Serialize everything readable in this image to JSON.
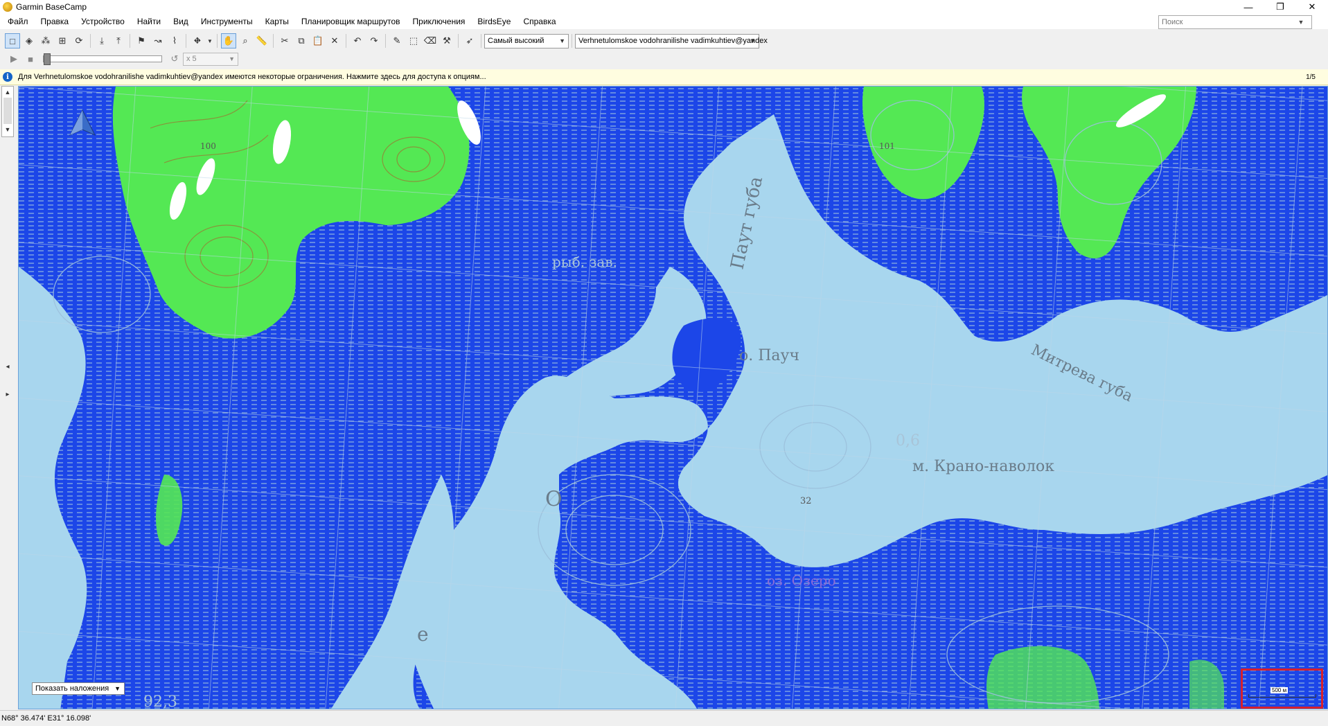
{
  "window": {
    "title": "Garmin BaseCamp",
    "controls": [
      "—",
      "❐",
      "✕"
    ]
  },
  "menu": [
    "Файл",
    "Правка",
    "Устройство",
    "Найти",
    "Вид",
    "Инструменты",
    "Карты",
    "Планировщик маршрутов",
    "Приключения",
    "BirdsEye",
    "Справка"
  ],
  "search": {
    "placeholder": "Поиск"
  },
  "toolbar": {
    "detail_level": "Самый высокий",
    "map_product": "Verhnetulomskoe vodohranilishe vadimkuhtiev@yandex",
    "speed": "x 5"
  },
  "info": {
    "message": "Для Verhnetulomskoe vodohranilishe vadimkuhtiev@yandex имеются некоторые ограничения. Нажмите здесь для доступа к опциям...",
    "page": "1/5"
  },
  "map": {
    "labels": {
      "paut_guba": "Паут губа",
      "o_pauch": "о. Пауч",
      "mitreva_guba": "Митрева губа",
      "krano_navolok": "м. Крано-наволок",
      "ryb_zav": "рыб. зав.",
      "depth_o": "О",
      "depth_e": "е",
      "h_100": "100",
      "h_101": "101",
      "h_6": "0,6",
      "h_32": "32",
      "h_92": "92,3",
      "lake": "оз. Озеро"
    },
    "colors": {
      "water": "#1c46e8",
      "lake": "#a8d6ee",
      "land": "#54e854",
      "grid": "#9cc0dc"
    }
  },
  "overlays_button": "Показать наложения",
  "scale": {
    "label": "500 м"
  },
  "status": {
    "coordinates": "N68° 36.474' E31° 16.098'"
  }
}
